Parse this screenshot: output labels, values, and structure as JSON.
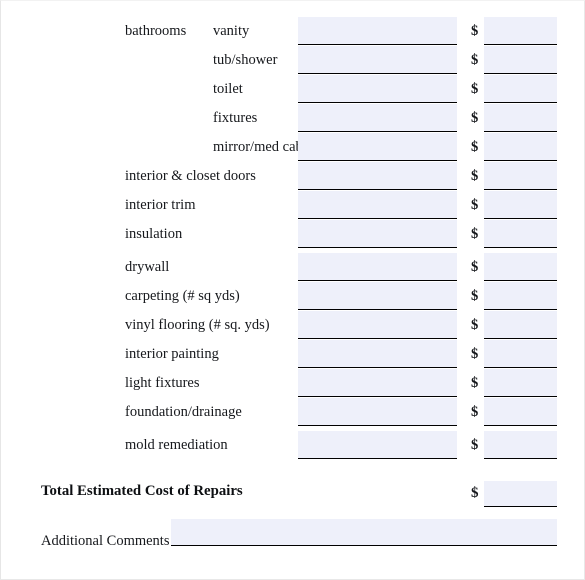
{
  "form": {
    "section_label": "bathrooms",
    "currency_symbol": "$",
    "field_value": "",
    "field_placeholder": "",
    "colors": {
      "field_background": "#eef0fa",
      "field_underline": "#000000",
      "page_background": "#ffffff",
      "text": "#16181c"
    },
    "rows": [
      {
        "label": "vanity",
        "indent": "inner",
        "qty_value": "",
        "amount_value": "",
        "gap_before": false
      },
      {
        "label": "tub/shower",
        "indent": "inner",
        "qty_value": "",
        "amount_value": "",
        "gap_before": false
      },
      {
        "label": "toilet",
        "indent": "inner",
        "qty_value": "",
        "amount_value": "",
        "gap_before": false
      },
      {
        "label": "fixtures",
        "indent": "inner",
        "qty_value": "",
        "amount_value": "",
        "gap_before": false
      },
      {
        "label": "mirror/med cab",
        "indent": "inner",
        "qty_value": "",
        "amount_value": "",
        "gap_before": false
      },
      {
        "label": "interior & closet doors",
        "indent": "outer",
        "qty_value": "",
        "amount_value": "",
        "gap_before": false
      },
      {
        "label": "interior trim",
        "indent": "outer",
        "qty_value": "",
        "amount_value": "",
        "gap_before": false
      },
      {
        "label": "insulation",
        "indent": "outer",
        "qty_value": "",
        "amount_value": "",
        "gap_before": false
      },
      {
        "label": "drywall",
        "indent": "outer",
        "qty_value": "",
        "amount_value": "",
        "gap_before": true
      },
      {
        "label": "carpeting (# sq yds)",
        "indent": "outer",
        "qty_value": "",
        "amount_value": "",
        "gap_before": false
      },
      {
        "label": "vinyl flooring (# sq. yds)",
        "indent": "outer",
        "qty_value": "",
        "amount_value": "",
        "gap_before": false
      },
      {
        "label": "interior painting",
        "indent": "outer",
        "qty_value": "",
        "amount_value": "",
        "gap_before": false
      },
      {
        "label": "light fixtures",
        "indent": "outer",
        "qty_value": "",
        "amount_value": "",
        "gap_before": false
      },
      {
        "label": "foundation/drainage",
        "indent": "outer",
        "qty_value": "",
        "amount_value": "",
        "gap_before": false
      },
      {
        "label": "mold remediation",
        "indent": "outer",
        "qty_value": "",
        "amount_value": "",
        "gap_before": true
      }
    ],
    "total": {
      "label": "Total Estimated Cost of Repairs",
      "currency_symbol": "$",
      "value": ""
    },
    "comments": {
      "label": "Additional Comments",
      "value": ""
    }
  }
}
